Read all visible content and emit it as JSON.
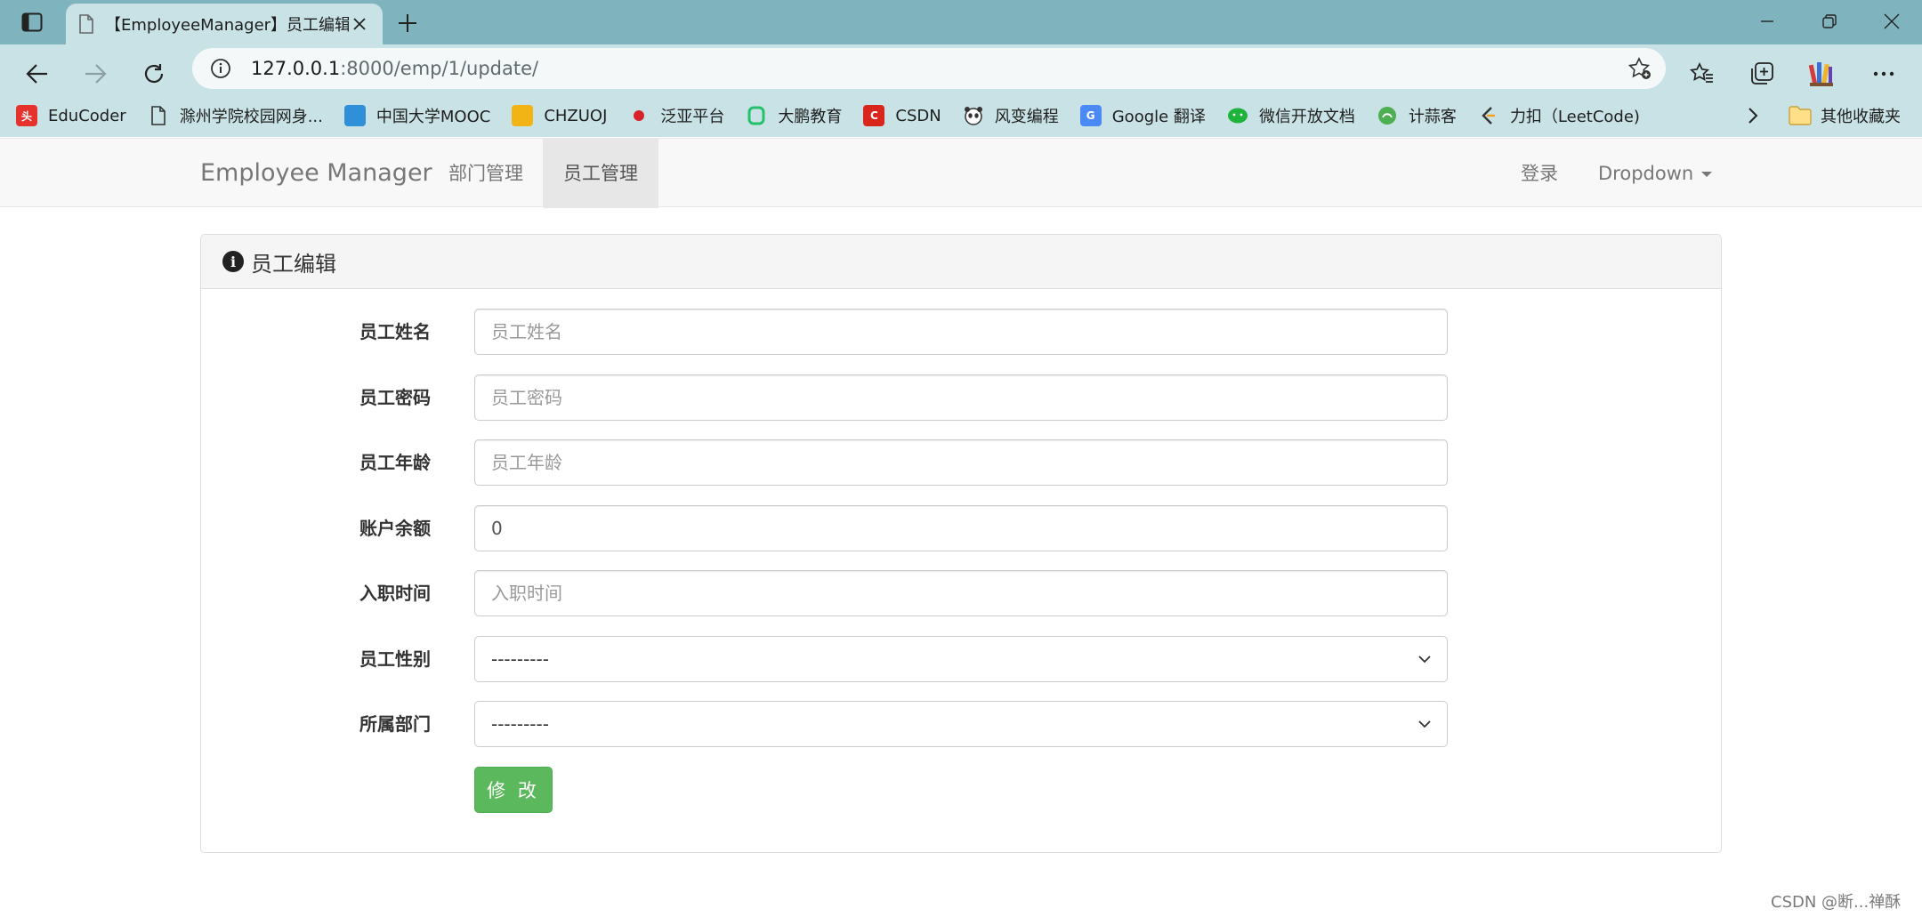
{
  "browser": {
    "tab_title": "【EmployeeManager】员工编辑",
    "url_host": "127.0.0.1",
    "url_rest": ":8000/emp/1/update/",
    "bookmarks": [
      {
        "label": "EduCoder",
        "icon": "educoder-icon",
        "color": "#e6322c"
      },
      {
        "label": "滁州学院校园网身...",
        "icon": "page-icon",
        "color": "#ffffff"
      },
      {
        "label": "中国大学MOOC",
        "icon": "mooc-icon",
        "color": "#2f8fd8"
      },
      {
        "label": "CHZUOJ",
        "icon": "chzuoj-icon",
        "color": "#f2b315"
      },
      {
        "label": "泛亚平台",
        "icon": "fanya-icon",
        "color": "#d6232a"
      },
      {
        "label": "大鹏教育",
        "icon": "dapeng-icon",
        "color": "#23c16b"
      },
      {
        "label": "CSDN",
        "icon": "csdn-icon",
        "color": "#d9261c"
      },
      {
        "label": "风变编程",
        "icon": "panda-icon",
        "color": "#555555"
      },
      {
        "label": "Google 翻译",
        "icon": "google-translate-icon",
        "color": "#4a8af4"
      },
      {
        "label": "微信开放文档",
        "icon": "wechat-icon",
        "color": "#20b33b"
      },
      {
        "label": "计蒜客",
        "icon": "jisuanke-icon",
        "color": "#4caf50"
      },
      {
        "label": "力扣（LeetCode)",
        "icon": "leetcode-icon",
        "color": "#f89f1b"
      }
    ],
    "other_bookmarks": "其他收藏夹"
  },
  "navbar": {
    "brand": "Employee Manager",
    "links": [
      "部门管理",
      "员工管理"
    ],
    "active_index": 1,
    "login": "登录",
    "dropdown": "Dropdown"
  },
  "panel": {
    "title": "员工编辑",
    "fields": [
      {
        "label": "员工姓名",
        "placeholder": "员工姓名",
        "value": ""
      },
      {
        "label": "员工密码",
        "placeholder": "员工密码",
        "value": ""
      },
      {
        "label": "员工年龄",
        "placeholder": "员工年龄",
        "value": ""
      },
      {
        "label": "账户余额",
        "placeholder": "",
        "value": "0"
      },
      {
        "label": "入职时间",
        "placeholder": "入职时间",
        "value": ""
      }
    ],
    "selects": [
      {
        "label": "员工性别",
        "value": "---------"
      },
      {
        "label": "所属部门",
        "value": "---------"
      }
    ],
    "submit": "修 改"
  },
  "watermark": "CSDN @断...禅酥",
  "colors": {
    "tabbar": "#7fb4be",
    "toolbar": "#c9e2e6",
    "success": "#5cb85c"
  }
}
